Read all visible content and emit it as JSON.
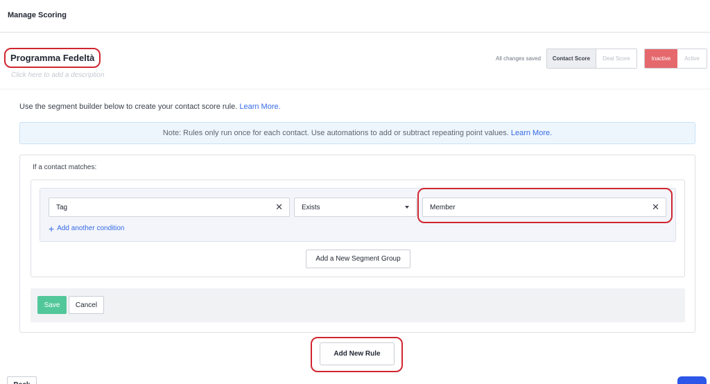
{
  "topbar": {
    "title": "Manage Scoring"
  },
  "rule": {
    "name": "Programma Fedeltà",
    "description_placeholder": "Click here to add a description"
  },
  "status": {
    "saved_text": "All changes saved",
    "score_types": [
      "Contact Score",
      "Deal Score"
    ],
    "score_type_selected": "Contact Score",
    "states": [
      "Inactive",
      "Active"
    ],
    "state_selected": "Inactive"
  },
  "intro": {
    "text": "Use the segment builder below to create your contact score rule.",
    "link": "Learn More."
  },
  "note": {
    "text": "Note: Rules only run once for each contact. Use automations to add or subtract repeating point values.",
    "link": "Learn More."
  },
  "builder": {
    "match_label": "If a contact matches:",
    "condition": {
      "field": "Tag",
      "operator": "Exists",
      "value": "Member"
    },
    "add_condition_label": "Add another condition",
    "add_group_label": "Add a New Segment Group",
    "save_label": "Save",
    "cancel_label": "Cancel"
  },
  "add_rule_label": "Add New Rule",
  "back_label": "Back",
  "icons": {
    "clear": "close-icon",
    "dropdown": "caret-down-icon",
    "add": "plus-icon"
  },
  "colors": {
    "accent_link": "#356ae6",
    "save_green": "#52c79a",
    "inactive_red": "#e5686c",
    "annotation_red": "#d0252f"
  }
}
